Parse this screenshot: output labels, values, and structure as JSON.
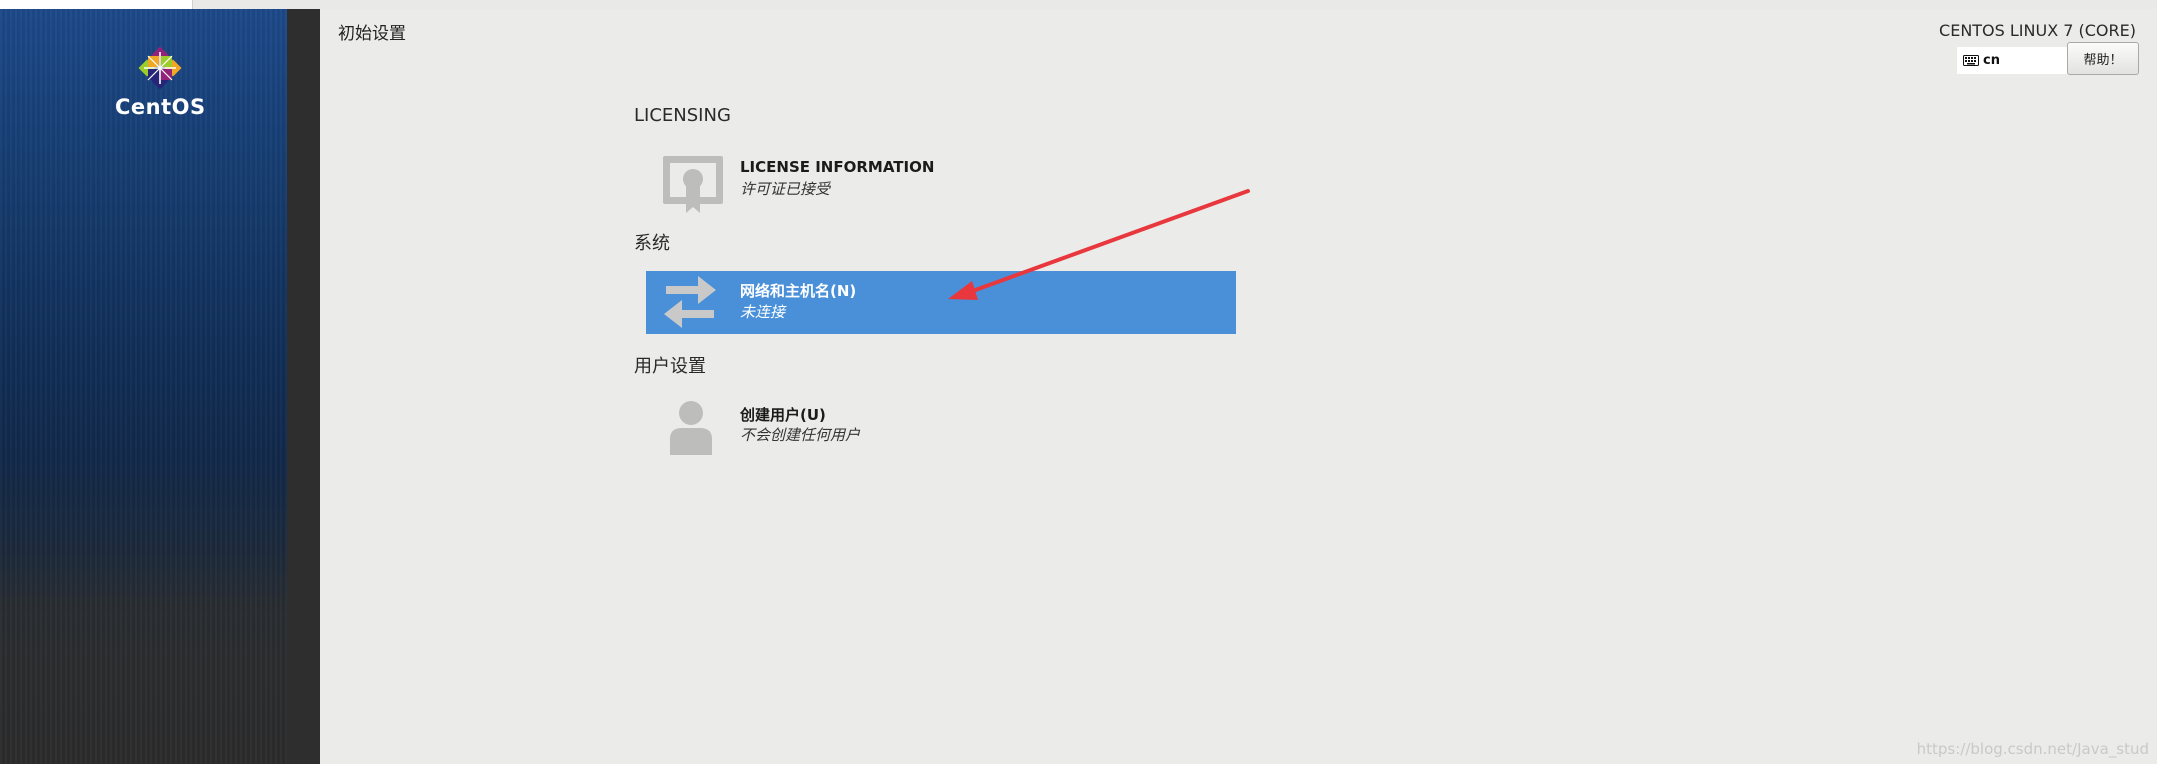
{
  "app": {
    "page_title": "初始设置",
    "distro_label": "CENTOS LINUX 7 (CORE)",
    "logo_text": "CentOS",
    "keyboard_layout": "cn",
    "help_label": "帮助！"
  },
  "sections": {
    "licensing": {
      "title": "LICENSING",
      "spokes": [
        {
          "name": "LICENSE INFORMATION",
          "status": "许可证已接受",
          "icon": "certificate-icon"
        }
      ]
    },
    "system": {
      "title": "系统",
      "spokes": [
        {
          "name": "网络和主机名(N)",
          "status": "未连接",
          "icon": "network-arrows-icon",
          "selected": true
        }
      ]
    },
    "user": {
      "title": "用户设置",
      "spokes": [
        {
          "name": "创建用户(U)",
          "status": "不会创建任何用户",
          "icon": "user-icon"
        }
      ]
    }
  },
  "colors": {
    "selected_spoke": "#4a90d9",
    "annotation_arrow": "#e8383d",
    "main_background": "#ebebe9"
  },
  "watermark": "https://blog.csdn.net/Java_stud"
}
